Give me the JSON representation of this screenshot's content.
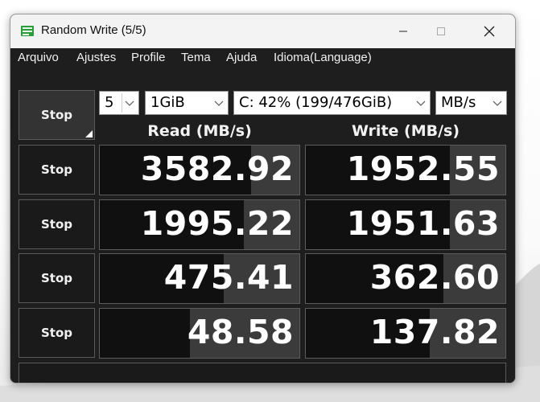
{
  "window": {
    "title": "Random Write (5/5)"
  },
  "menu": [
    "Arquivo",
    "Ajustes",
    "Profile",
    "Tema",
    "Ajuda",
    "Idioma(Language)"
  ],
  "controls": {
    "main_button": "Stop",
    "count": "5",
    "size": "1GiB",
    "drive": "C: 42% (199/476GiB)",
    "unit": "MB/s"
  },
  "headers": {
    "read": "Read (MB/s)",
    "write": "Write (MB/s)"
  },
  "rows": [
    {
      "button": "Stop",
      "read": "3582.92",
      "write": "1952.55",
      "read_level": 0.24,
      "write_level": 0.28
    },
    {
      "button": "Stop",
      "read": "1995.22",
      "write": "1951.63",
      "read_level": 0.28,
      "write_level": 0.28
    },
    {
      "button": "Stop",
      "read": "475.41",
      "write": "362.60",
      "read_level": 0.38,
      "write_level": 0.31
    },
    {
      "button": "Stop",
      "read": "48.58",
      "write": "137.82",
      "read_level": 0.55,
      "write_level": 0.38
    }
  ],
  "colors": {
    "background": "#1e1e1e",
    "cell": "#101010",
    "meter": "#3b3b3b",
    "text": "#ffffff",
    "titlebar": "#f3f3f3"
  },
  "icons": {
    "app": "disk-mark-icon",
    "minimize": "minimize-icon",
    "maximize": "maximize-icon",
    "close": "close-icon",
    "dropdown": "chevron-down-icon"
  }
}
